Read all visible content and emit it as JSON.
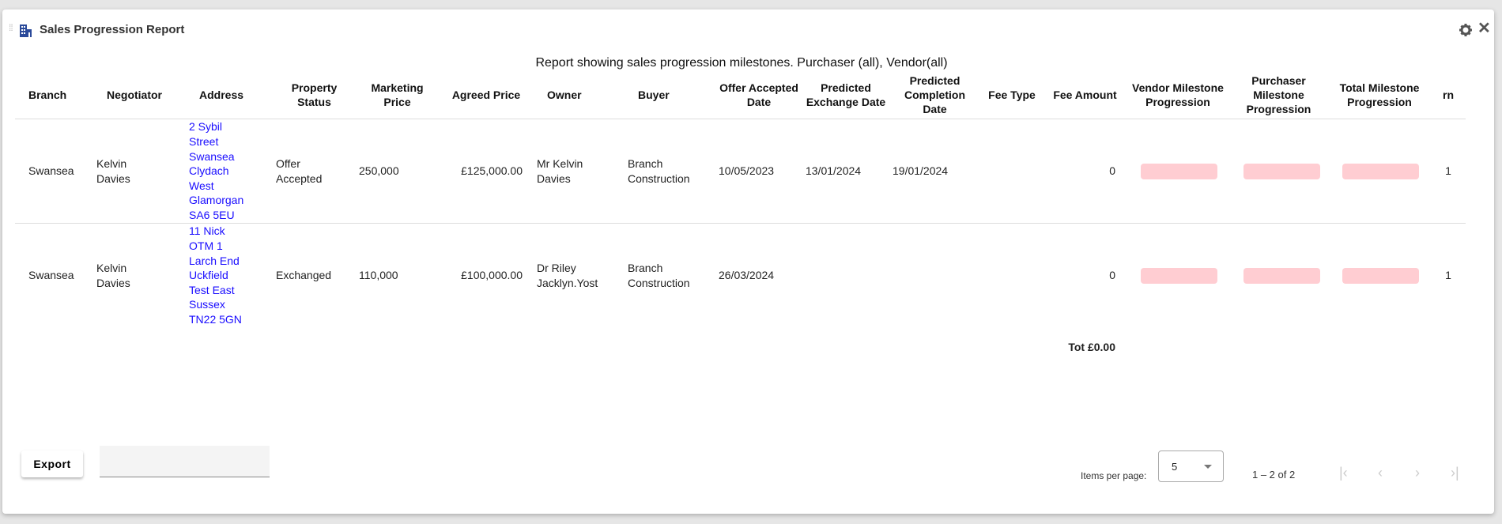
{
  "window": {
    "title": "Sales Progression Report",
    "icons": [
      "drag-handle-icon",
      "building-icon",
      "gear-icon",
      "close-icon"
    ]
  },
  "caption": "Report showing sales progression milestones. Purchaser (all), Vendor(all)",
  "columns": [
    "Branch",
    "Negotiator",
    "Address",
    "Property Status",
    "Marketing Price",
    "Agreed Price",
    "Owner",
    "Buyer",
    "Offer Accepted Date",
    "Predicted Exchange Date",
    "Predicted Completion Date",
    "Fee Type",
    "Fee Amount",
    "Vendor Milestone Progression",
    "Purchaser Milestone Progression",
    "Total Milestone Progression",
    "rn"
  ],
  "rows": [
    {
      "branch": "Swansea",
      "negotiator": "Kelvin Davies",
      "address": "2 Sybil Street Swansea Clydach West Glamorgan SA6 5EU",
      "status": "Offer Accepted",
      "marketing_price": "250,000",
      "agreed_price": "£125,000.00",
      "owner": "Mr Kelvin Davies",
      "buyer": "Branch Construction",
      "offer_accepted": "10/05/2023",
      "predicted_exchange": "13/01/2024",
      "predicted_completion": "19/01/2024",
      "fee_type": "",
      "fee_amount": "0",
      "vendor_progress": 0,
      "purchaser_progress": 0,
      "total_progress": 0,
      "rn": "1"
    },
    {
      "branch": "Swansea",
      "negotiator": "Kelvin Davies",
      "address": "11 Nick OTM 1 Larch End Uckfield Test East Sussex TN22 5GN",
      "status": "Exchanged",
      "marketing_price": "110,000",
      "agreed_price": "£100,000.00",
      "owner": "Dr Riley Jacklyn.Yost",
      "buyer": "Branch Construction",
      "offer_accepted": "26/03/2024",
      "predicted_exchange": "",
      "predicted_completion": "",
      "fee_type": "",
      "fee_amount": "0",
      "vendor_progress": 0,
      "purchaser_progress": 0,
      "total_progress": 0,
      "rn": "1"
    }
  ],
  "total": "Tot £0.00",
  "progress_bar_color": "#ffcdd2",
  "footer": {
    "export_label": "Export",
    "filter_value": "",
    "items_per_page_label": "Items per page:",
    "items_per_page": "5",
    "range": "1 – 2 of 2"
  }
}
